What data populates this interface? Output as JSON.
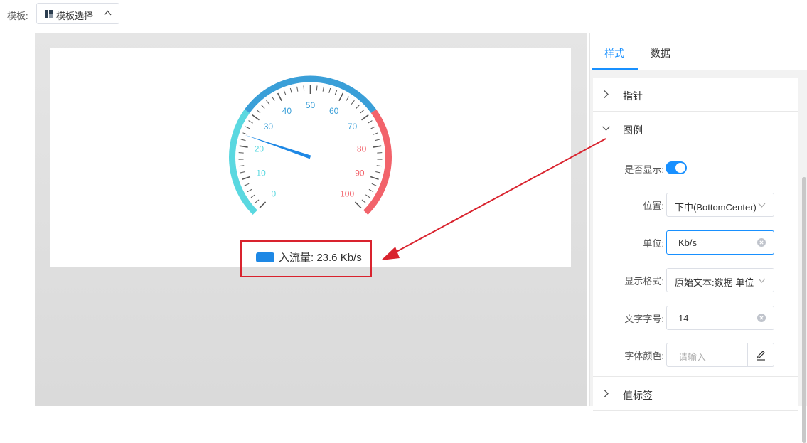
{
  "toolbar": {
    "template_label": "模板:",
    "template_button": "模板选择"
  },
  "gauge": {
    "value": 23.6,
    "min": 0,
    "max": 100,
    "tick_labels": [
      "0",
      "10",
      "20",
      "30",
      "40",
      "50",
      "60",
      "70",
      "80",
      "90",
      "100"
    ],
    "colors": {
      "low": "#5ad8e0",
      "mid": "#3a9fd8",
      "high": "#f2636b",
      "pointer": "#1e88e5"
    }
  },
  "legend": {
    "text": "入流量: 23.6 Kb/s",
    "color": "#1e88e5"
  },
  "panel": {
    "tabs": [
      {
        "label": "样式",
        "active": true
      },
      {
        "label": "数据",
        "active": false
      }
    ],
    "sections": {
      "pointer": {
        "title": "指针",
        "expanded": false
      },
      "legend": {
        "title": "图例",
        "expanded": true
      },
      "value_label": {
        "title": "值标签",
        "expanded": false
      }
    },
    "fields": {
      "show": {
        "label": "是否显示:",
        "on": true
      },
      "position": {
        "label": "位置:",
        "value": "下中(BottomCenter)"
      },
      "unit": {
        "label": "单位:",
        "value": "Kb/s"
      },
      "format": {
        "label": "显示格式:",
        "value": "原始文本:数据 单位"
      },
      "font_size": {
        "label": "文字字号:",
        "value": "14"
      },
      "font_color": {
        "label": "字体颜色:",
        "placeholder": "请输入"
      }
    }
  },
  "colors": {
    "accent": "#1890ff",
    "annotation": "#d9232e"
  }
}
